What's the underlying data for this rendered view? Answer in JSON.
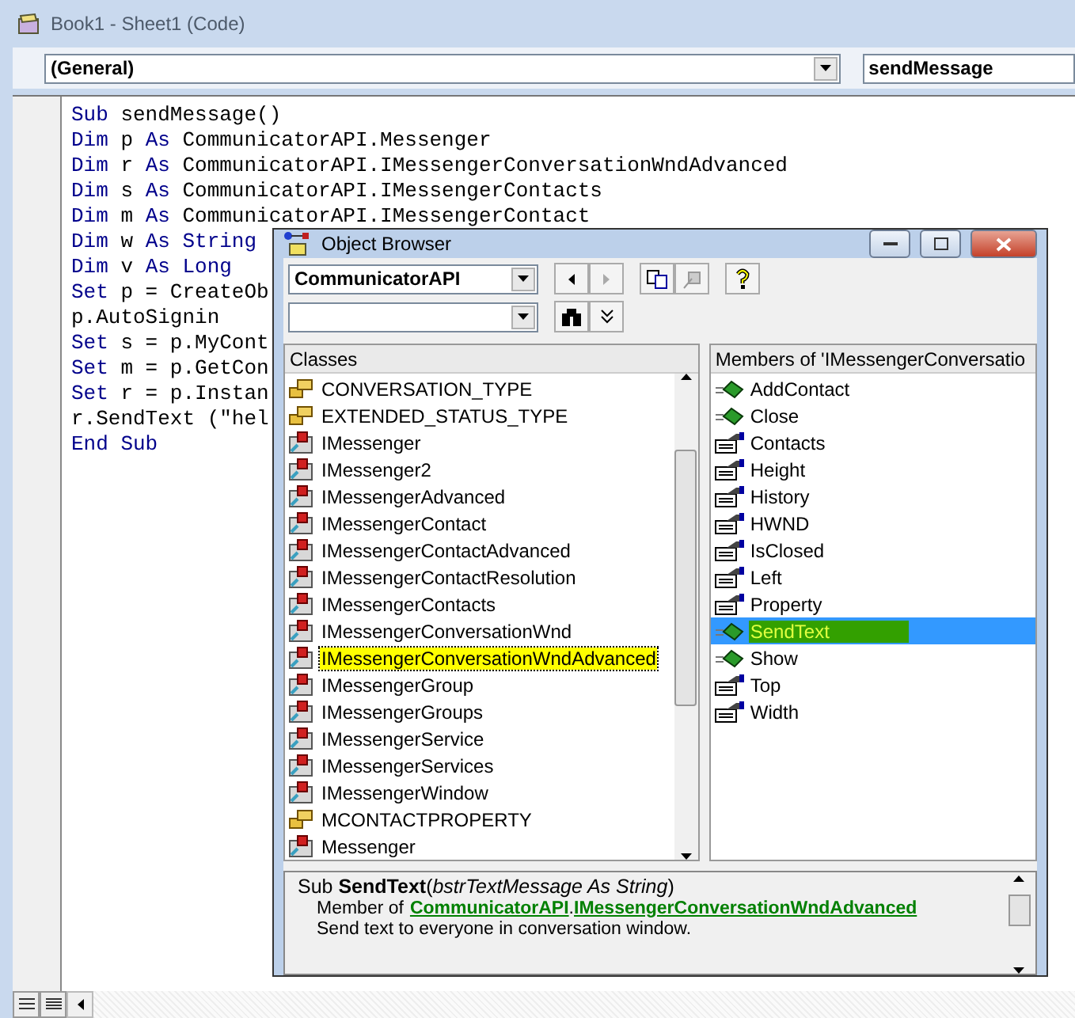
{
  "window": {
    "title": "Book1 - Sheet1 (Code)"
  },
  "object_combo": {
    "value": "(General)"
  },
  "procedure_combo": {
    "value": "sendMessage"
  },
  "code_lines": [
    [
      {
        "text": "Sub",
        "keyword": true
      },
      {
        "text": " sendMessage()",
        "keyword": false
      }
    ],
    [
      {
        "text": "Dim",
        "keyword": true
      },
      {
        "text": " p ",
        "keyword": false
      },
      {
        "text": "As",
        "keyword": true
      },
      {
        "text": " CommunicatorAPI.Messenger",
        "keyword": false
      }
    ],
    [
      {
        "text": "Dim",
        "keyword": true
      },
      {
        "text": " r ",
        "keyword": false
      },
      {
        "text": "As",
        "keyword": true
      },
      {
        "text": " CommunicatorAPI.IMessengerConversationWndAdvanced",
        "keyword": false
      }
    ],
    [
      {
        "text": "Dim",
        "keyword": true
      },
      {
        "text": " s ",
        "keyword": false
      },
      {
        "text": "As",
        "keyword": true
      },
      {
        "text": " CommunicatorAPI.IMessengerContacts",
        "keyword": false
      }
    ],
    [
      {
        "text": "Dim",
        "keyword": true
      },
      {
        "text": " m ",
        "keyword": false
      },
      {
        "text": "As",
        "keyword": true
      },
      {
        "text": " CommunicatorAPI.IMessengerContact",
        "keyword": false
      }
    ],
    [
      {
        "text": "Dim",
        "keyword": true
      },
      {
        "text": " w ",
        "keyword": false
      },
      {
        "text": "As String",
        "keyword": true
      }
    ],
    [
      {
        "text": "Dim",
        "keyword": true
      },
      {
        "text": " v ",
        "keyword": false
      },
      {
        "text": "As Long",
        "keyword": true
      }
    ],
    [
      {
        "text": "Set",
        "keyword": true
      },
      {
        "text": " p = CreateOb",
        "keyword": false
      }
    ],
    [
      {
        "text": "p.AutoSignin",
        "keyword": false
      }
    ],
    [
      {
        "text": "Set",
        "keyword": true
      },
      {
        "text": " s = p.MyCont",
        "keyword": false
      }
    ],
    [
      {
        "text": "Set",
        "keyword": true
      },
      {
        "text": " m = p.GetCon",
        "keyword": false
      }
    ],
    [
      {
        "text": "Set",
        "keyword": true
      },
      {
        "text": " r = p.Instan",
        "keyword": false
      }
    ],
    [
      {
        "text": "r.SendText (\"hel",
        "keyword": false
      }
    ],
    [
      {
        "text": "End Sub",
        "keyword": true
      }
    ]
  ],
  "object_browser": {
    "title": "Object Browser",
    "library_combo": {
      "value": "CommunicatorAPI"
    },
    "classes_header": "Classes",
    "classes": [
      {
        "name": "CONVERSATION_TYPE",
        "kind": "enum",
        "selected": false
      },
      {
        "name": "EXTENDED_STATUS_TYPE",
        "kind": "enum",
        "selected": false
      },
      {
        "name": "IMessenger",
        "kind": "class",
        "selected": false
      },
      {
        "name": "IMessenger2",
        "kind": "class",
        "selected": false
      },
      {
        "name": "IMessengerAdvanced",
        "kind": "class",
        "selected": false
      },
      {
        "name": "IMessengerContact",
        "kind": "class",
        "selected": false
      },
      {
        "name": "IMessengerContactAdvanced",
        "kind": "class",
        "selected": false
      },
      {
        "name": "IMessengerContactResolution",
        "kind": "class",
        "selected": false
      },
      {
        "name": "IMessengerContacts",
        "kind": "class",
        "selected": false
      },
      {
        "name": "IMessengerConversationWnd",
        "kind": "class",
        "selected": false
      },
      {
        "name": "IMessengerConversationWndAdvanced",
        "kind": "class",
        "selected": true
      },
      {
        "name": "IMessengerGroup",
        "kind": "class",
        "selected": false
      },
      {
        "name": "IMessengerGroups",
        "kind": "class",
        "selected": false
      },
      {
        "name": "IMessengerService",
        "kind": "class",
        "selected": false
      },
      {
        "name": "IMessengerServices",
        "kind": "class",
        "selected": false
      },
      {
        "name": "IMessengerWindow",
        "kind": "class",
        "selected": false
      },
      {
        "name": "MCONTACTPROPERTY",
        "kind": "enum",
        "selected": false
      },
      {
        "name": "Messenger",
        "kind": "class",
        "selected": false
      }
    ],
    "members_header": "Members of 'IMessengerConversatio",
    "members": [
      {
        "name": "AddContact",
        "kind": "method",
        "selected": false
      },
      {
        "name": "Close",
        "kind": "method",
        "selected": false
      },
      {
        "name": "Contacts",
        "kind": "property",
        "selected": false
      },
      {
        "name": "Height",
        "kind": "property",
        "selected": false
      },
      {
        "name": "History",
        "kind": "property",
        "selected": false
      },
      {
        "name": "HWND",
        "kind": "property",
        "selected": false
      },
      {
        "name": "IsClosed",
        "kind": "property",
        "selected": false
      },
      {
        "name": "Left",
        "kind": "property",
        "selected": false
      },
      {
        "name": "Property",
        "kind": "property",
        "selected": false
      },
      {
        "name": "SendText",
        "kind": "method",
        "selected": true
      },
      {
        "name": "Show",
        "kind": "method",
        "selected": false
      },
      {
        "name": "Top",
        "kind": "property",
        "selected": false
      },
      {
        "name": "Width",
        "kind": "property",
        "selected": false
      }
    ],
    "details": {
      "signature": "Sub **SendText**(*bstrTextMessage As String*)",
      "member_of": "Member of",
      "library_link": "CommunicatorAPI",
      "separator": ".",
      "class_link": "IMessengerConversationWndAdvanced",
      "description": "Send text to everyone in conversation window."
    }
  }
}
